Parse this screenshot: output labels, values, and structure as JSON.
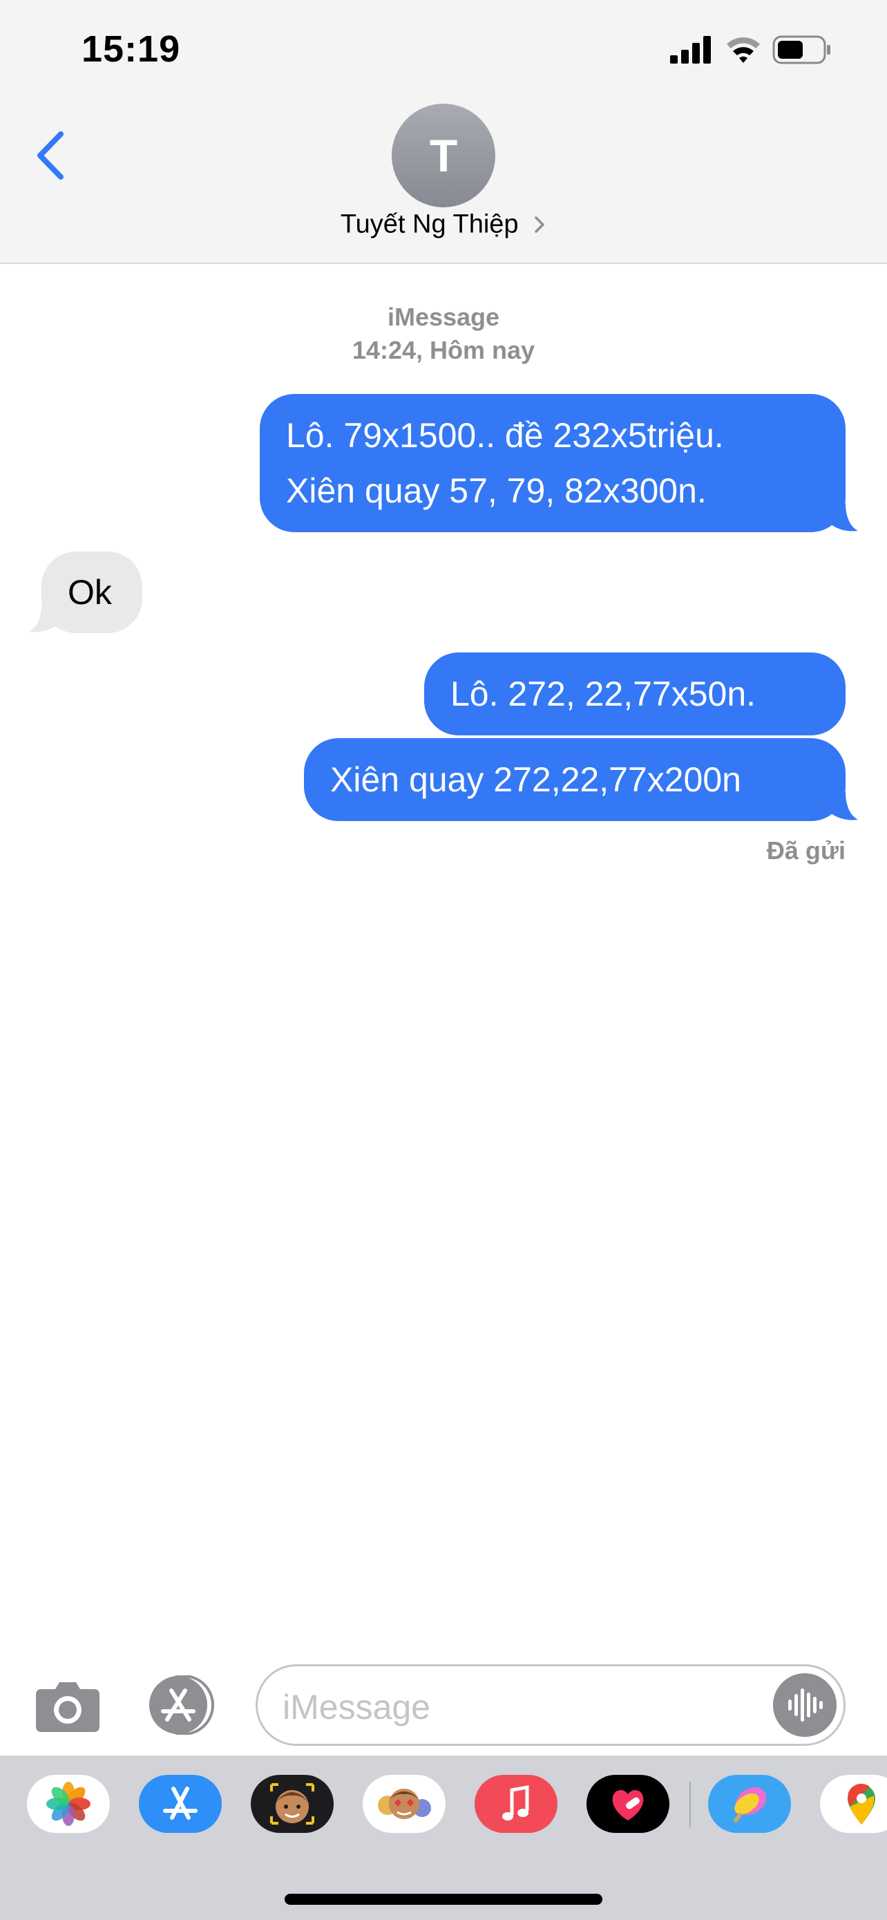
{
  "status_bar": {
    "time": "15:19",
    "icons": [
      "signal-icon",
      "wifi-icon",
      "battery-icon"
    ]
  },
  "header": {
    "back_icon": "chevron-left-icon",
    "avatar_initial": "T",
    "contact_name": "Tuyết Ng Thiệp",
    "contact_chevron_icon": "chevron-right-icon"
  },
  "conversation": {
    "service_label": "iMessage",
    "time_label": "14:24,",
    "day_label": "Hôm nay",
    "messages": [
      {
        "direction": "outgoing",
        "lines": [
          "Lô. 79x1500.. đề 232x5triệu.",
          "Xiên quay 57, 79, 82x300n."
        ]
      },
      {
        "direction": "incoming",
        "lines": [
          "Ok"
        ]
      },
      {
        "direction": "outgoing",
        "lines": [
          "Lô. 272, 22,77x50n."
        ]
      },
      {
        "direction": "outgoing",
        "lines": [
          "Xiên quay 272,22,77x200n"
        ]
      }
    ],
    "delivery_status": "Đã gửi"
  },
  "composer": {
    "camera_icon": "camera-icon",
    "apps_icon": "app-store-icon",
    "placeholder": "iMessage",
    "voice_icon": "waveform-icon"
  },
  "app_drawer": {
    "apps": [
      "photos-icon",
      "app-store-icon",
      "memoji-icon",
      "memoji-stickers-icon",
      "music-icon",
      "fitness-icon",
      "sticker-app-icon",
      "maps-icon"
    ]
  },
  "colors": {
    "outgoing_bubble": "#3478f5",
    "incoming_bubble": "#e9e9eb",
    "accent": "#3478f5",
    "header_bg": "#f4f4f4",
    "secondary_text": "#8e8e93",
    "drawer_bg": "#d1d3d9"
  }
}
